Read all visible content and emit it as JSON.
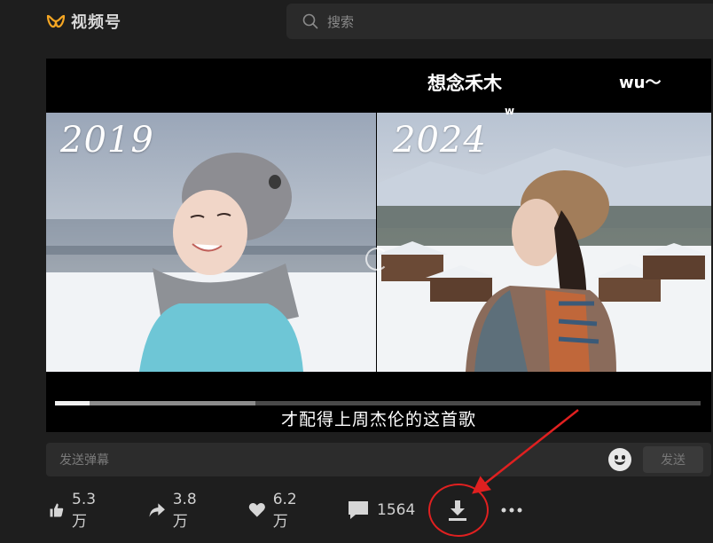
{
  "header": {
    "brand_name": "视频号",
    "logo_color": "#f5a623",
    "search_placeholder": "搜索"
  },
  "video": {
    "caption_top": "想念禾木",
    "caption_wu": "wu〜",
    "year_left": "2019",
    "year_right": "2024",
    "w_mark": "w",
    "subtitle": "才配得上周杰伦的这首歌",
    "progress_played": 0.054,
    "progress_buffered": 0.31
  },
  "danmu": {
    "placeholder": "发送弹幕",
    "send_label": "发送"
  },
  "actions": {
    "like_count": "5.3万",
    "share_count": "3.8万",
    "favorite_count": "6.2万",
    "comment_count": "1564"
  },
  "annotation_color": "#e02020"
}
